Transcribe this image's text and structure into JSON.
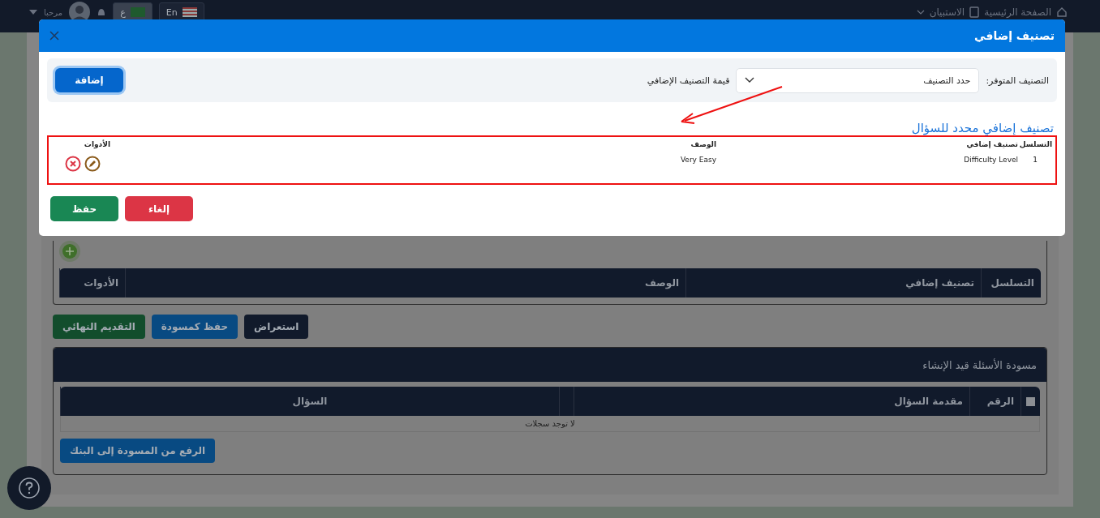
{
  "top_bar": {
    "home": "الصفحة الرئيسية",
    "survey": "الاستبيان",
    "lang_ar": "ع",
    "lang_en": "En",
    "greeting": "مرحبا"
  },
  "modal": {
    "title": "تصنيف إضافي",
    "available_label": "التصنيف المتوفر:",
    "select": {
      "placeholder": "حدد التصنيف"
    },
    "value_label": "قيمة التصنيف الإضافي",
    "add_button": "إضافة",
    "section_title": "تصنيف إضافي محدد للسؤال",
    "columns": [
      "التسلسل",
      "تصنيف إضافي",
      "الوصف",
      "الأدوات"
    ],
    "rows": [
      {
        "seq": "1",
        "category": "Difficulty Level",
        "description": "Very Easy"
      }
    ],
    "buttons": [
      {
        "label": "إلغاء",
        "kind": "cancel"
      },
      {
        "label": "حفظ",
        "kind": "save"
      }
    ]
  },
  "page": {
    "columns": [
      "التسلسل",
      "تصنيف إضافي",
      "الوصف",
      "الأدوات"
    ],
    "actions": [
      {
        "label": "استعراض",
        "kind": "dark"
      },
      {
        "label": "حفظ كمسودة",
        "kind": "blue"
      },
      {
        "label": "التقديم النهائي",
        "kind": "green"
      }
    ],
    "drafts": {
      "title": "مسودة الأسئلة قيد الإنشاء",
      "select_all_checked": false,
      "columns": [
        "الرقم",
        "مقدمة السؤال",
        "السؤال"
      ],
      "empty_message": "لا توجد سجلات",
      "upload_button": "الرفع من المسودة إلى البنك"
    }
  }
}
